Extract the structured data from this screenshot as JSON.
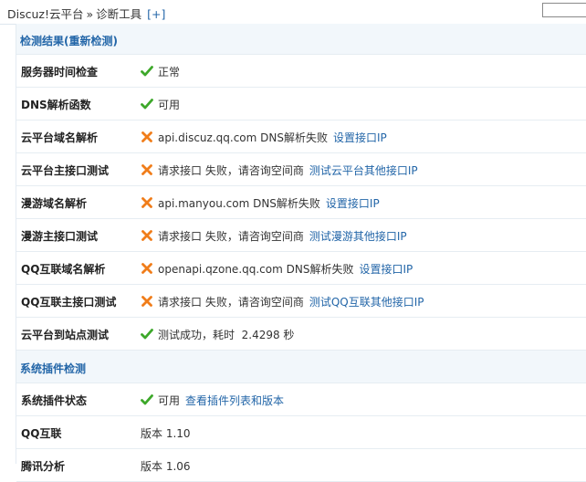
{
  "breadcrumb": {
    "root": "Discuz!云平台",
    "separator": "»",
    "current": "诊断工具",
    "add": "[+]"
  },
  "sections": [
    {
      "title": "检测结果",
      "action": "(重新检测)"
    },
    {
      "title": "系统插件检测"
    }
  ],
  "rows": [
    {
      "label": "服务器时间检查",
      "status": "ok",
      "text": "正常",
      "link": ""
    },
    {
      "label": "DNS解析函数",
      "status": "ok",
      "text": "可用",
      "link": ""
    },
    {
      "label": "云平台域名解析",
      "status": "fail",
      "text": "api.discuz.qq.com DNS解析失败",
      "link": "设置接口IP"
    },
    {
      "label": "云平台主接口测试",
      "status": "fail",
      "text": "请求接口 失败，请咨询空间商",
      "link": "测试云平台其他接口IP"
    },
    {
      "label": "漫游域名解析",
      "status": "fail",
      "text": "api.manyou.com DNS解析失败",
      "link": "设置接口IP"
    },
    {
      "label": "漫游主接口测试",
      "status": "fail",
      "text": "请求接口 失败，请咨询空间商",
      "link": "测试漫游其他接口IP"
    },
    {
      "label": "QQ互联域名解析",
      "status": "fail",
      "text": "openapi.qzone.qq.com DNS解析失败",
      "link": "设置接口IP"
    },
    {
      "label": "QQ互联主接口测试",
      "status": "fail",
      "text": "请求接口 失败，请咨询空间商",
      "link": "测试QQ互联其他接口IP"
    },
    {
      "label": "云平台到站点测试",
      "status": "ok",
      "text": "测试成功，耗时  2.4298 秒",
      "link": ""
    }
  ],
  "plugin_rows": [
    {
      "label": "系统插件状态",
      "status": "ok",
      "text": "可用",
      "link": "查看插件列表和版本"
    },
    {
      "label": "QQ互联",
      "status": "none",
      "text": "版本 1.10",
      "link": ""
    },
    {
      "label": "腾讯分析",
      "status": "none",
      "text": "版本 1.06",
      "link": ""
    }
  ],
  "colors": {
    "ok": "#3da82a",
    "fail": "#f07d1a",
    "link": "#2366a8",
    "header_bg": "#f2f7fb"
  }
}
